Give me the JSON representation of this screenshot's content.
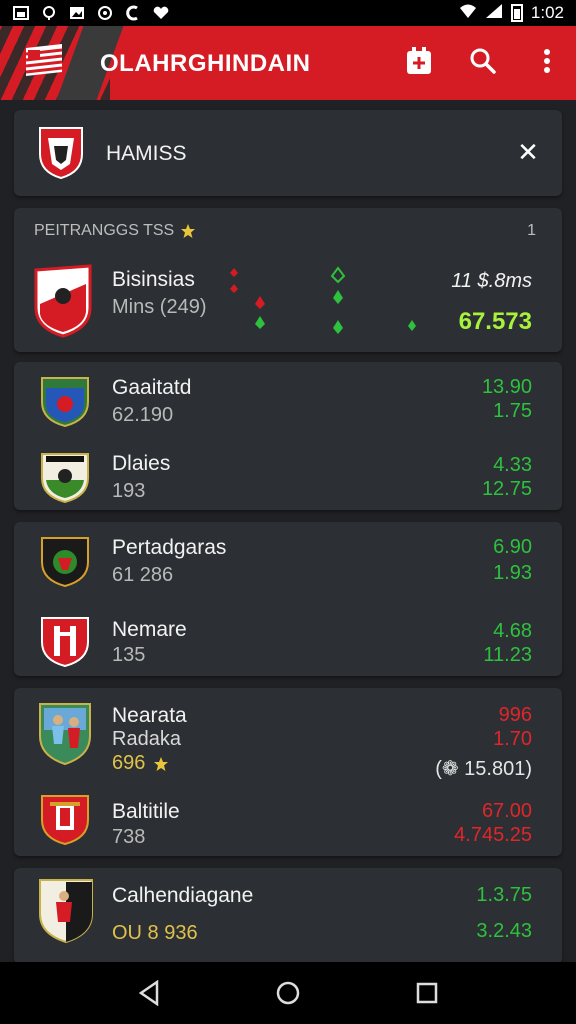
{
  "status_bar": {
    "time": "1:02"
  },
  "app": {
    "title": "OLAHRGHINDAIN"
  },
  "search_card": {
    "title": "HAMISS"
  },
  "featured": {
    "header": "PEITRANGGS TSS",
    "count": "1",
    "team": "Bisinsias",
    "sub": "Mins (249)",
    "top_value": "11 $.8ms",
    "bottom_value": "67.573"
  },
  "groups": [
    {
      "rows": [
        {
          "name": "Gaaitatd",
          "sub": "62.190",
          "top": "13.90",
          "bottom": "1.75"
        },
        {
          "name": "Dlaies",
          "sub": "193",
          "top": "4.33",
          "bottom": "12.75"
        }
      ]
    },
    {
      "rows": [
        {
          "name": "Pertadgaras",
          "sub": "61 286",
          "top": "6.90",
          "bottom": "1.93"
        },
        {
          "name": "Nemare",
          "sub": "135",
          "top": "4.68",
          "bottom": "11.23"
        }
      ]
    },
    {
      "rows": [
        {
          "name": "Nearata",
          "sub": "Radaka",
          "extra": "696",
          "top": "996",
          "mid": "1.70",
          "bottom": "(❁ 15.801)"
        },
        {
          "name": "Baltitile",
          "sub": "738",
          "top": "67.00",
          "bottom": "4.745.25"
        }
      ]
    },
    {
      "rows": [
        {
          "name": "Calhendiagane",
          "sub": "OU 8 936",
          "top": "1.3.75",
          "bottom": "3.2.43"
        }
      ]
    }
  ],
  "colors": {
    "accent": "#d51c24",
    "positive": "#2ec13e",
    "negative": "#e0262a",
    "highlight": "#a8f23c",
    "card": "#2c2f33",
    "background": "#1f2124"
  },
  "icons": [
    "status-photo-icon",
    "status-notification-icon",
    "wifi-icon",
    "signal-icon",
    "battery-icon",
    "add-event-icon",
    "search-icon",
    "more-vert-icon",
    "close-icon",
    "star-icon",
    "back-icon",
    "home-icon",
    "recents-icon"
  ]
}
